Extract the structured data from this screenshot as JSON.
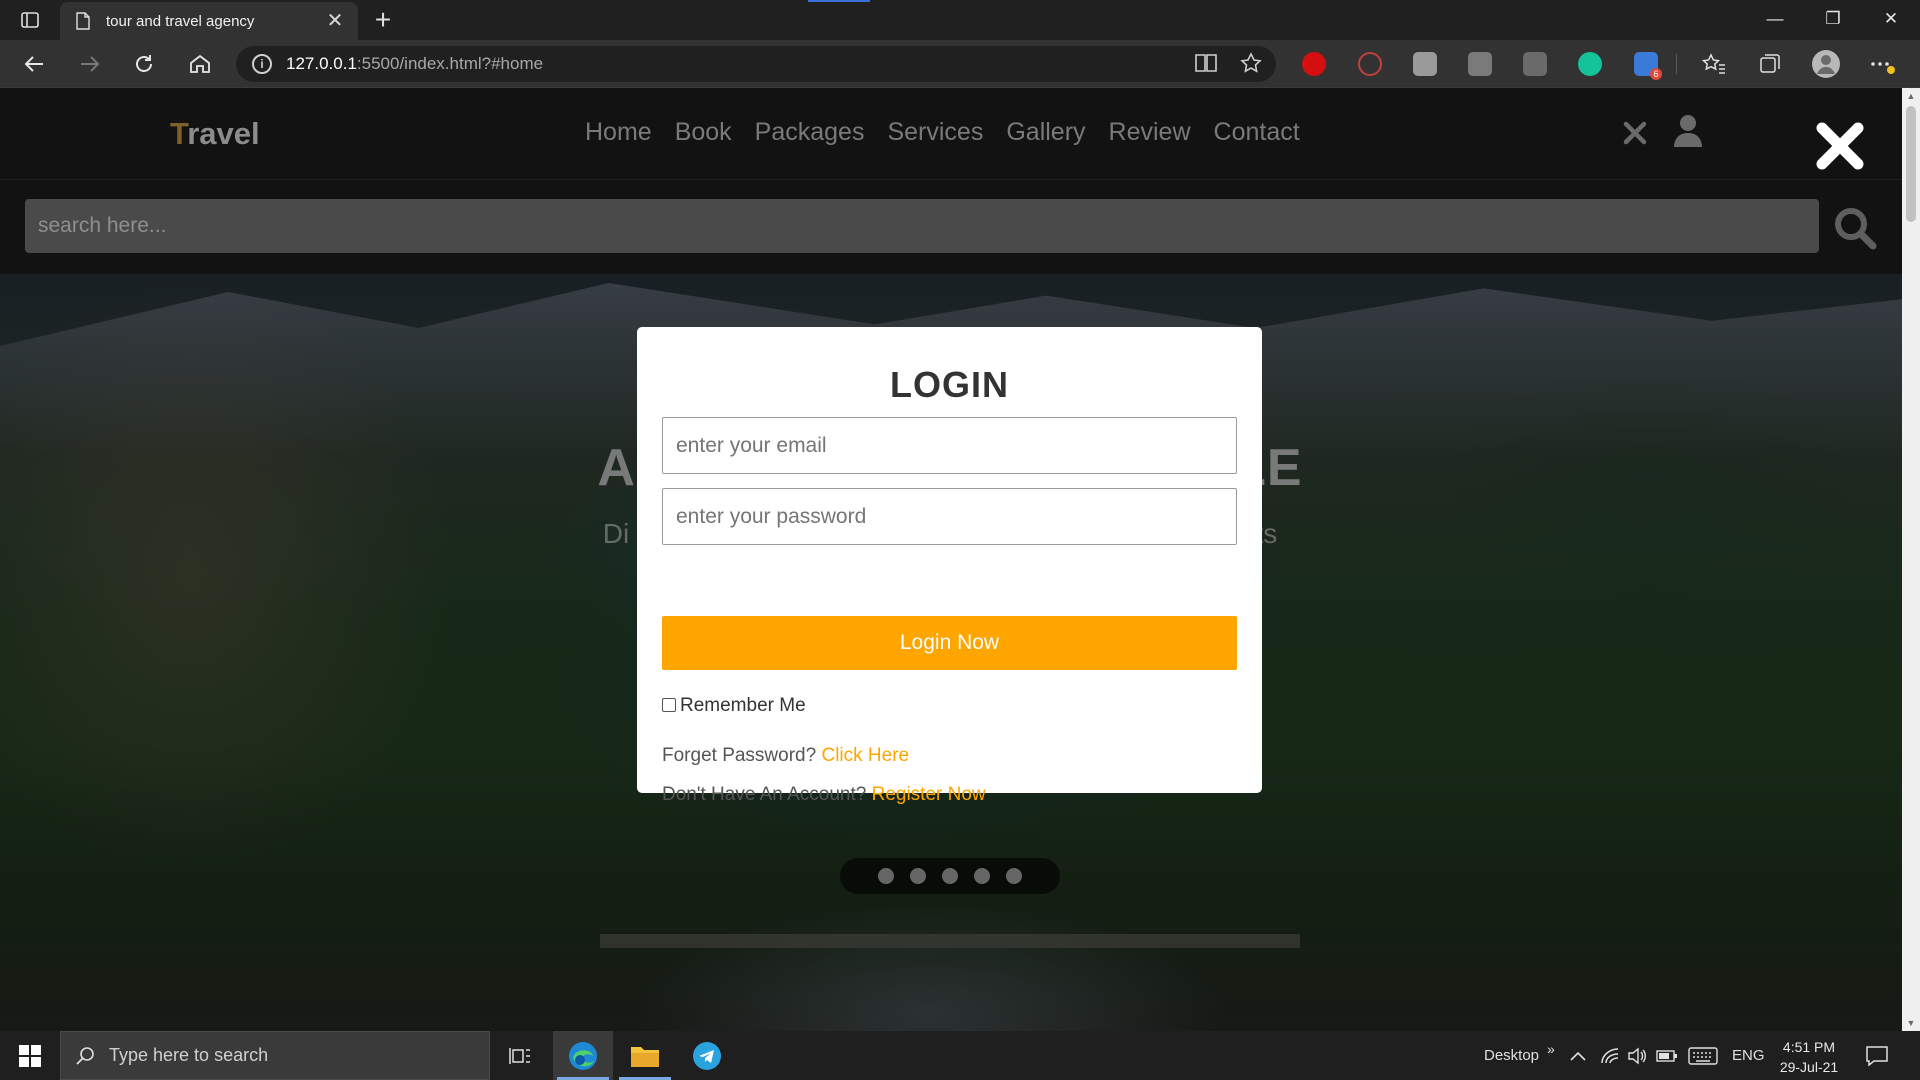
{
  "browser": {
    "tab_title": "tour and travel agency",
    "url_host": "127.0.0.1",
    "url_rest": ":5500/index.html?#home",
    "ext_badge_count": "6"
  },
  "site": {
    "logo_first": "T",
    "logo_rest": "ravel",
    "nav": [
      "Home",
      "Book",
      "Packages",
      "Services",
      "Gallery",
      "Review",
      "Contact"
    ],
    "search_placeholder": "search here..."
  },
  "hero": {
    "title_left": "ADV",
    "title_right": "HILE",
    "sub_left": "Di",
    "sub_right": "its"
  },
  "login": {
    "heading": "LOGIN",
    "email_placeholder": "enter your email",
    "password_placeholder": "enter your password",
    "submit_label": "Login Now",
    "remember_label": "Remember Me",
    "forgot_text": "Forget Password?",
    "forgot_link": "Click Here",
    "register_text": "Don't Have An Account?",
    "register_link": "Register Now"
  },
  "taskbar": {
    "search_placeholder": "Type here to search",
    "desktop_label": "Desktop",
    "lang": "ENG",
    "time": "4:51 PM",
    "date": "29-Jul-21"
  },
  "colors": {
    "accent": "#ffa500",
    "modal_bg": "#ffffff",
    "header_bg": "#121212"
  }
}
